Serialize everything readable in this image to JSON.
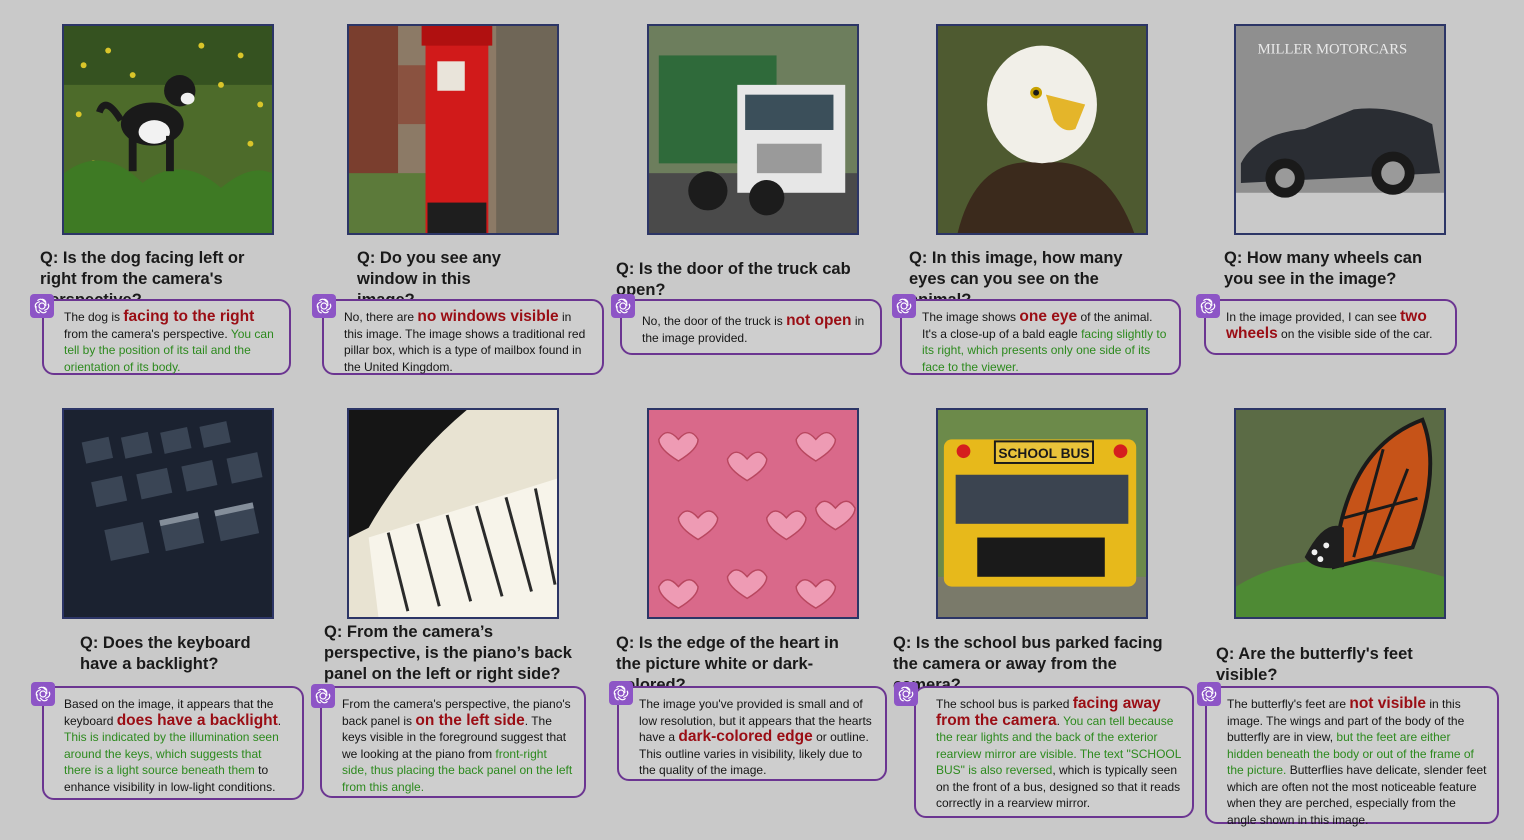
{
  "icons": {
    "assistant": "openai-logo-icon"
  },
  "colors": {
    "highlight": "#9a0d14",
    "evidence": "#2d8a1e",
    "bubble_border": "#6b3591",
    "frame": "#2c3566"
  },
  "cards": [
    {
      "question": "Q: Is the dog facing left or right from the camera's perspective?",
      "answer": [
        {
          "t": "The dog is ",
          "s": ""
        },
        {
          "t": "facing to the right",
          "s": "hl"
        },
        {
          "t": " from the camera's perspective. ",
          "s": ""
        },
        {
          "t": "You can tell by the position of its tail and the orientation of its body.",
          "s": "ev"
        }
      ]
    },
    {
      "question": "Q: Do you see any window in this image?",
      "answer": [
        {
          "t": "No, there are ",
          "s": ""
        },
        {
          "t": "no windows visible",
          "s": "hl"
        },
        {
          "t": " in this image. The image shows a traditional red pillar box, which is a type of mailbox found in the United Kingdom.",
          "s": ""
        }
      ]
    },
    {
      "question": "Q: Is the door of the truck cab open?",
      "answer": [
        {
          "t": "No, the door of the truck is ",
          "s": ""
        },
        {
          "t": "not open",
          "s": "hl"
        },
        {
          "t": " in the image provided.",
          "s": ""
        }
      ]
    },
    {
      "question": "Q: In this image, how many eyes can you see on the animal?",
      "answer": [
        {
          "t": "The image shows ",
          "s": ""
        },
        {
          "t": "one eye",
          "s": "hl"
        },
        {
          "t": " of the animal. It's a close-up of a bald eagle ",
          "s": ""
        },
        {
          "t": "facing slightly to its right, which presents only one side of its face to the viewer.",
          "s": "ev"
        }
      ]
    },
    {
      "question": "Q: How many wheels can you see in the image?",
      "photo_text": "MILLER MOTORCARS",
      "answer": [
        {
          "t": "In the image provided, I can see ",
          "s": ""
        },
        {
          "t": "two wheels",
          "s": "hl"
        },
        {
          "t": " on the visible side of the car.",
          "s": ""
        }
      ]
    },
    {
      "question": "Q: Does the keyboard have a backlight?",
      "answer": [
        {
          "t": "Based on the image, it appears that the keyboard ",
          "s": ""
        },
        {
          "t": "does have a backlight",
          "s": "hl"
        },
        {
          "t": ". ",
          "s": ""
        },
        {
          "t": "This is indicated by the illumination seen around the keys, which suggests that there is a light source beneath them",
          "s": "ev"
        },
        {
          "t": " to enhance visibility in low-light conditions.",
          "s": ""
        }
      ]
    },
    {
      "question": "Q: From the camera’s perspective, is the piano’s back panel on the left or right side?",
      "answer": [
        {
          "t": "From the camera's perspective, the piano's back panel is ",
          "s": ""
        },
        {
          "t": "on the left side",
          "s": "hl"
        },
        {
          "t": ". The keys visible in the foreground suggest that we looking at the piano from ",
          "s": ""
        },
        {
          "t": "front-right side, thus placing the back panel on the left from this angle.",
          "s": "ev"
        }
      ]
    },
    {
      "question": "Q: Is the edge of the heart in the picture white or dark-colored?",
      "answer": [
        {
          "t": "The image you've provided is small and of low resolution, but it appears that the hearts have a ",
          "s": ""
        },
        {
          "t": "dark-colored edge",
          "s": "hl"
        },
        {
          "t": " or outline. This outline varies in visibility, likely due to the quality of the image.",
          "s": ""
        }
      ]
    },
    {
      "question": "Q: Is the school bus parked facing the camera or away from the camera?",
      "photo_text": "SCHOOL BUS",
      "answer": [
        {
          "t": "The school bus is parked ",
          "s": ""
        },
        {
          "t": "facing away from the camera",
          "s": "hl"
        },
        {
          "t": ". ",
          "s": ""
        },
        {
          "t": "You can tell because the rear lights and the back of the exterior rearview mirror are visible. The text \"SCHOOL BUS\" is also reversed",
          "s": "ev"
        },
        {
          "t": ", which is typically seen on the front of a bus, designed so that it reads correctly in a rearview mirror.",
          "s": ""
        }
      ]
    },
    {
      "question": "Q: Are the butterfly's feet visible?",
      "answer": [
        {
          "t": "The butterfly's feet are ",
          "s": ""
        },
        {
          "t": "not visible",
          "s": "hl"
        },
        {
          "t": " in this image. The wings and part of the body of the butterfly are in view, ",
          "s": ""
        },
        {
          "t": "but the feet are either hidden beneath the body or out of the frame of the picture.",
          "s": "ev"
        },
        {
          "t": " Butterflies have delicate, slender feet which are often not the most noticeable feature when they are perched, especially from the angle shown in this image.",
          "s": ""
        }
      ]
    }
  ]
}
